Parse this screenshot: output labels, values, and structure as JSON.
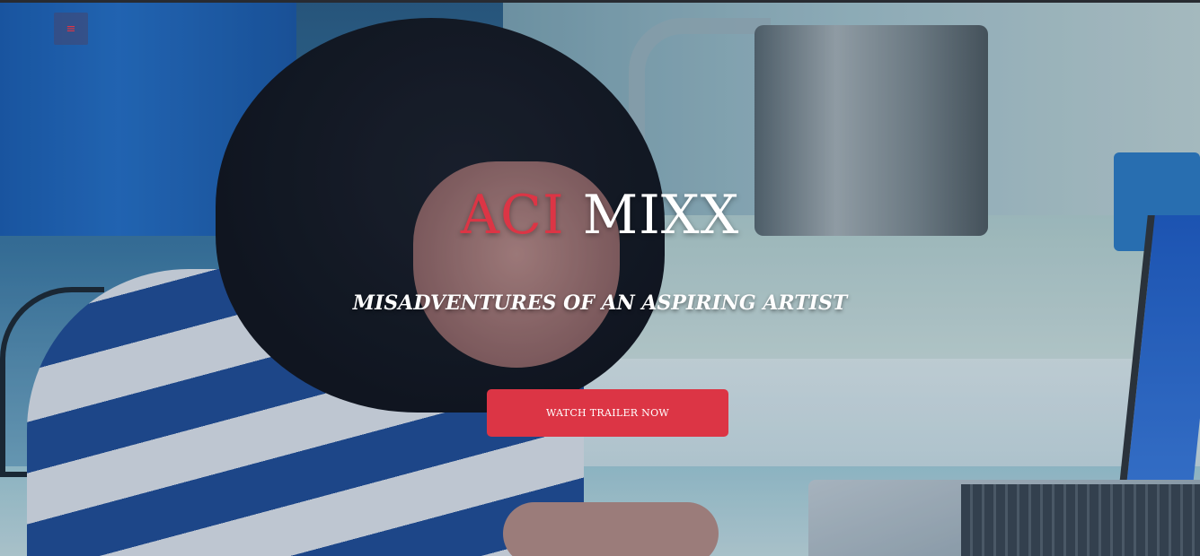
{
  "nav": {
    "menu_icon": "bars-icon",
    "menu_glyph": "≡"
  },
  "hero": {
    "title_accent": "ACI",
    "title_rest": "MIXX",
    "subtitle": "MISADVENTURES OF AN ASPIRING ARTIST",
    "cta_label": "WATCH TRAILER NOW"
  },
  "colors": {
    "accent": "#dc3545",
    "text": "#ffffff"
  }
}
